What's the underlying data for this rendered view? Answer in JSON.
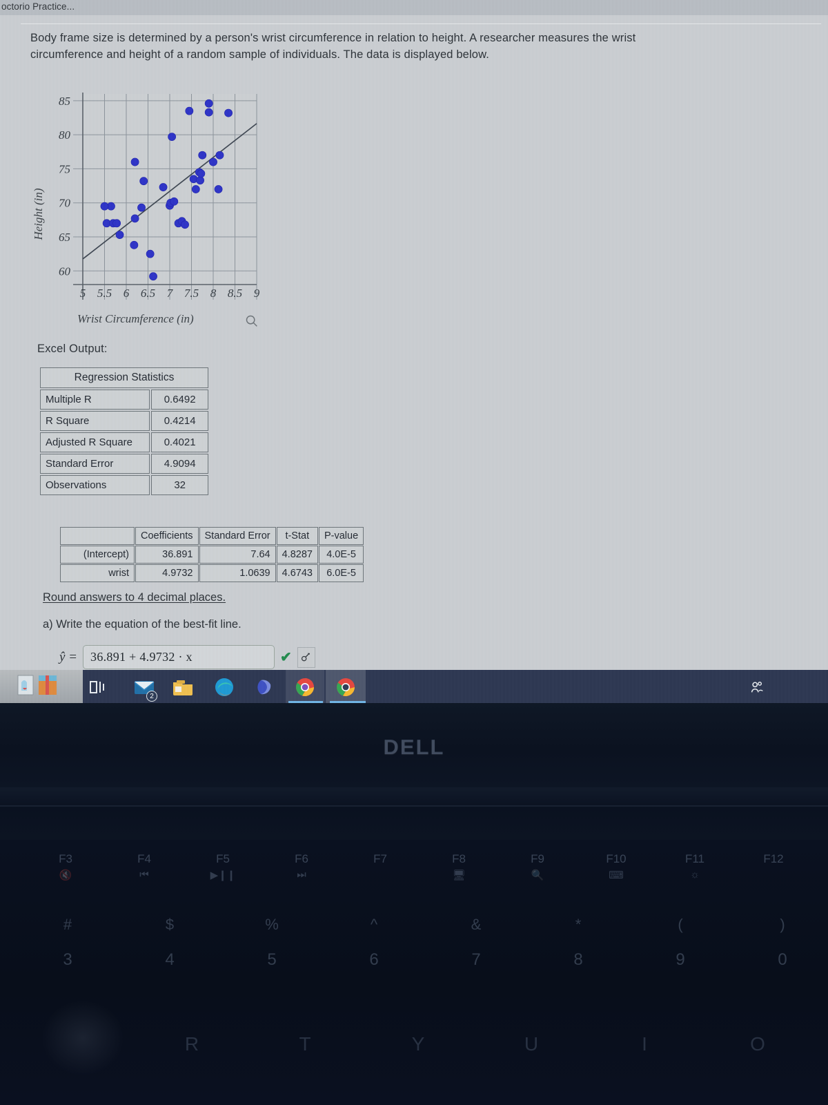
{
  "browser": {
    "tab_title": "octorio Practice..."
  },
  "question": {
    "prompt": "Body frame size is determined by a person's wrist circumference in relation to height. A researcher measures the wrist circumference and height of a random sample of individuals. The data is displayed below.",
    "excel_label": "Excel Output:",
    "round_note": "Round answers to 4 decimal places.",
    "part_a": "a) Write the equation of the best-fit line.",
    "yhat_label": "ŷ =",
    "answer_value": "36.891 + 4.9732 · x",
    "answer_placeholder": "",
    "check_glyph": "✔"
  },
  "regression_statistics": {
    "header": "Regression Statistics",
    "rows": [
      {
        "label": "Multiple R",
        "value": "0.6492"
      },
      {
        "label": "R Square",
        "value": "0.4214"
      },
      {
        "label": "Adjusted R Square",
        "value": "0.4021"
      },
      {
        "label": "Standard Error",
        "value": "4.9094"
      },
      {
        "label": "Observations",
        "value": "32"
      }
    ]
  },
  "coefficients_table": {
    "columns": [
      "",
      "Coefficients",
      "Standard Error",
      "t-Stat",
      "P-value"
    ],
    "rows": [
      {
        "name": "(Intercept)",
        "coefficient": "36.891",
        "standard_error": "7.64",
        "t_stat": "4.8287",
        "p_value": "4.0E-5"
      },
      {
        "name": "wrist",
        "coefficient": "4.9732",
        "standard_error": "1.0639",
        "t_stat": "4.6743",
        "p_value": "6.0E-5"
      }
    ]
  },
  "chart_data": {
    "type": "scatter",
    "title": "",
    "xlabel": "Wrist Circumference (in)",
    "ylabel": "Height (in)",
    "xlim": [
      5,
      9
    ],
    "ylim": [
      58,
      86
    ],
    "xticks": [
      "5",
      "5.5",
      "6",
      "6.5",
      "7",
      "7.5",
      "8",
      "8.5",
      "9"
    ],
    "yticks": [
      "60",
      "65",
      "70",
      "75",
      "80",
      "85"
    ],
    "grid": true,
    "point_color": "#2b31c8",
    "trendline_color": "#3c4450",
    "trendline": {
      "intercept": 36.891,
      "slope": 4.9732
    },
    "points": [
      [
        5.55,
        67.0
      ],
      [
        5.65,
        69.5
      ],
      [
        5.7,
        67.0
      ],
      [
        5.5,
        69.5
      ],
      [
        5.85,
        65.3
      ],
      [
        5.78,
        67.0
      ],
      [
        6.2,
        76.0
      ],
      [
        6.2,
        67.7
      ],
      [
        6.18,
        63.8
      ],
      [
        6.35,
        69.3
      ],
      [
        6.4,
        73.2
      ],
      [
        6.55,
        62.5
      ],
      [
        6.62,
        59.2
      ],
      [
        6.85,
        72.3
      ],
      [
        7.0,
        69.6
      ],
      [
        7.02,
        70.0
      ],
      [
        7.1,
        70.2
      ],
      [
        7.2,
        67.0
      ],
      [
        7.28,
        67.3
      ],
      [
        7.35,
        66.8
      ],
      [
        7.05,
        79.7
      ],
      [
        7.45,
        83.5
      ],
      [
        7.55,
        73.5
      ],
      [
        7.6,
        72.0
      ],
      [
        7.68,
        74.5
      ],
      [
        7.7,
        73.3
      ],
      [
        7.72,
        74.3
      ],
      [
        7.75,
        77.0
      ],
      [
        7.9,
        84.6
      ],
      [
        7.9,
        83.3
      ],
      [
        8.0,
        76.0
      ],
      [
        8.12,
        72.0
      ],
      [
        8.15,
        77.0
      ],
      [
        8.35,
        83.2
      ]
    ]
  },
  "taskbar": {
    "icons": [
      {
        "name": "task-view-icon",
        "glyph": "⊟"
      },
      {
        "name": "mail-icon",
        "badge": "2"
      },
      {
        "name": "file-explorer-icon",
        "glyph": ""
      },
      {
        "name": "edge-icon",
        "glyph": ""
      },
      {
        "name": "office-icon",
        "glyph": ""
      },
      {
        "name": "chrome-icon-1",
        "glyph": ""
      },
      {
        "name": "chrome-icon-2",
        "glyph": ""
      }
    ],
    "tray_icon": "people-icon"
  },
  "laptop": {
    "brand": "DELL",
    "function_keys": [
      {
        "label": "F3",
        "sub": "🔇"
      },
      {
        "label": "F4",
        "sub": "⏮"
      },
      {
        "label": "F5",
        "sub": "▶❙❙"
      },
      {
        "label": "F6",
        "sub": "⏭"
      },
      {
        "label": "F7",
        "sub": ""
      },
      {
        "label": "F8",
        "sub": "🖥"
      },
      {
        "label": "F9",
        "sub": "🔍"
      },
      {
        "label": "F10",
        "sub": "⌨"
      },
      {
        "label": "F11",
        "sub": "☼"
      },
      {
        "label": "F12",
        "sub": ""
      }
    ],
    "number_keys": [
      {
        "symbol": "#",
        "number": "3"
      },
      {
        "symbol": "$",
        "number": "4"
      },
      {
        "symbol": "%",
        "number": "5"
      },
      {
        "symbol": "^",
        "number": "6"
      },
      {
        "symbol": "&",
        "number": "7"
      },
      {
        "symbol": "*",
        "number": "8"
      },
      {
        "symbol": "(",
        "number": "9"
      },
      {
        "symbol": ")",
        "number": "0"
      }
    ],
    "letter_keys": [
      "R",
      "T",
      "Y",
      "U",
      "I",
      "O"
    ]
  }
}
